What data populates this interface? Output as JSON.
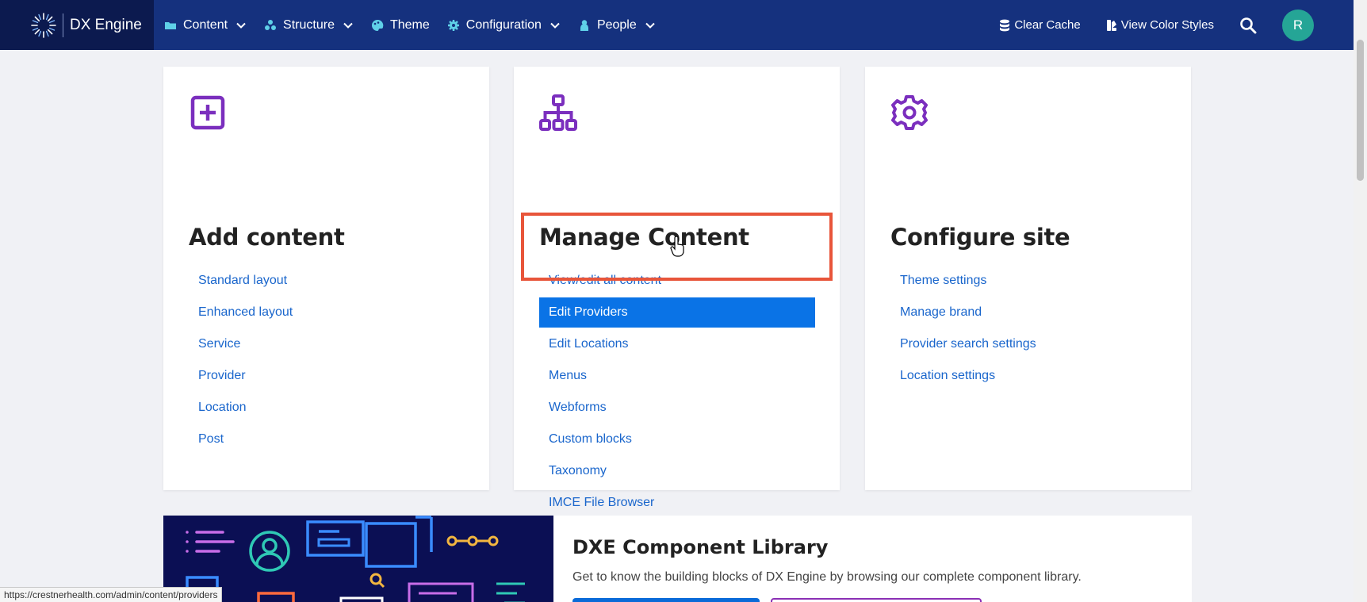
{
  "brand": {
    "name": "DX Engine"
  },
  "nav": [
    {
      "label": "Content",
      "icon": "folder-icon",
      "dropdown": true
    },
    {
      "label": "Structure",
      "icon": "sitemap-icon",
      "dropdown": true
    },
    {
      "label": "Theme",
      "icon": "palette-icon",
      "dropdown": false
    },
    {
      "label": "Configuration",
      "icon": "gear-icon",
      "dropdown": true
    },
    {
      "label": "People",
      "icon": "person-icon",
      "dropdown": true
    }
  ],
  "actions": {
    "clear_cache": "Clear Cache",
    "view_color_styles": "View Color Styles"
  },
  "user": {
    "initial": "R"
  },
  "cards": {
    "add": {
      "title": "Add content",
      "links": [
        "Standard layout",
        "Enhanced layout",
        "Service",
        "Provider",
        "Location",
        "Post"
      ]
    },
    "manage": {
      "title": "Manage Content",
      "links": [
        "View/edit all content",
        "Edit Providers",
        "Edit Locations",
        "Menus",
        "Webforms",
        "Custom blocks",
        "Taxonomy",
        "IMCE File Browser"
      ],
      "active_link": "Edit Providers"
    },
    "config": {
      "title": "Configure site",
      "links": [
        "Theme settings",
        "Manage brand",
        "Provider search settings",
        "Location settings"
      ]
    }
  },
  "library": {
    "title": "DXE Component Library",
    "description": "Get to know the building blocks of DX Engine by browsing our complete component library."
  },
  "status_bar": {
    "url": "https://crestnerhealth.com/admin/content/providers"
  },
  "colors": {
    "topbar": "#15317e",
    "brand_bg": "#0c1a4f",
    "link": "#1a66cc",
    "active": "#0a73e6",
    "icon_purple": "#7b2fbe",
    "highlight": "#e8553a",
    "avatar": "#25a596"
  }
}
